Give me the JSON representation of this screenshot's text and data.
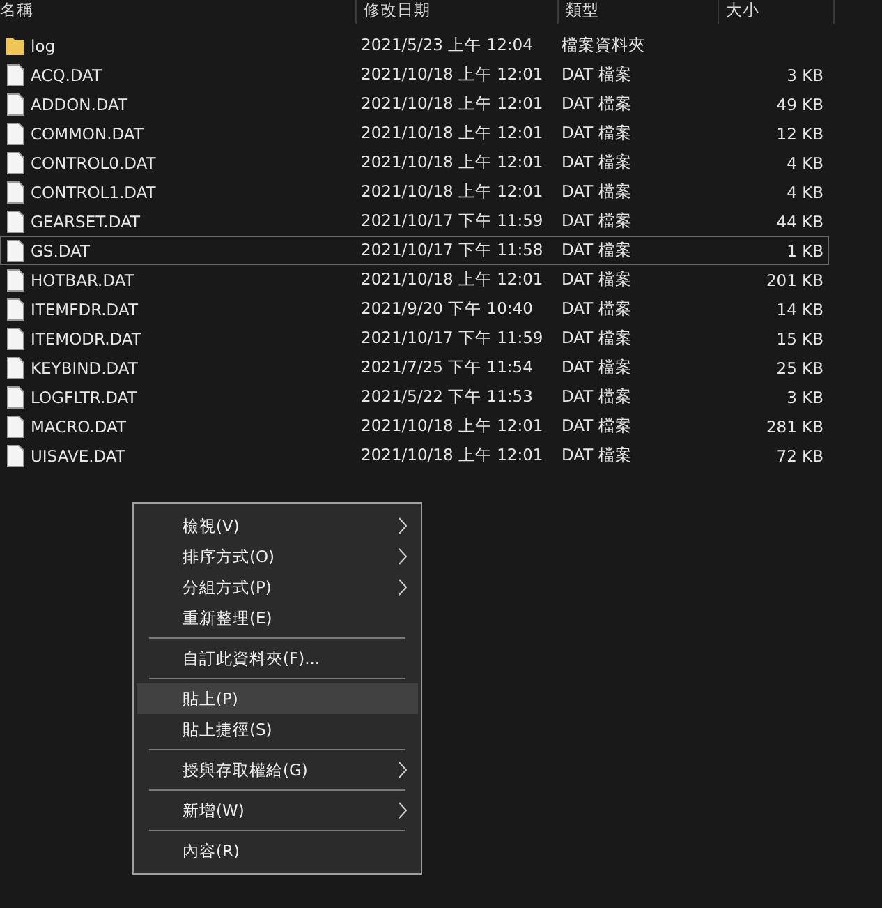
{
  "columns": [
    {
      "label": "名稱"
    },
    {
      "label": "修改日期"
    },
    {
      "label": "類型"
    },
    {
      "label": "大小"
    }
  ],
  "files": [
    {
      "kind": "folder",
      "name": "log",
      "modified": "2021/5/23 上午 12:04",
      "type": "檔案資料夾",
      "focused": false
    },
    {
      "kind": "file",
      "name": "ACQ.DAT",
      "modified": "2021/10/18 上午 12:01",
      "type": "DAT 檔案",
      "size": "3 KB",
      "focused": false
    },
    {
      "kind": "file",
      "name": "ADDON.DAT",
      "modified": "2021/10/18 上午 12:01",
      "type": "DAT 檔案",
      "size": "49 KB",
      "focused": false
    },
    {
      "kind": "file",
      "name": "COMMON.DAT",
      "modified": "2021/10/18 上午 12:01",
      "type": "DAT 檔案",
      "size": "12 KB",
      "focused": false
    },
    {
      "kind": "file",
      "name": "CONTROL0.DAT",
      "modified": "2021/10/18 上午 12:01",
      "type": "DAT 檔案",
      "size": "4 KB",
      "focused": false
    },
    {
      "kind": "file",
      "name": "CONTROL1.DAT",
      "modified": "2021/10/18 上午 12:01",
      "type": "DAT 檔案",
      "size": "4 KB",
      "focused": false
    },
    {
      "kind": "file",
      "name": "GEARSET.DAT",
      "modified": "2021/10/17 下午 11:59",
      "type": "DAT 檔案",
      "size": "44 KB",
      "focused": false
    },
    {
      "kind": "file",
      "name": "GS.DAT",
      "modified": "2021/10/17 下午 11:58",
      "type": "DAT 檔案",
      "size": "1 KB",
      "focused": true
    },
    {
      "kind": "file",
      "name": "HOTBAR.DAT",
      "modified": "2021/10/18 上午 12:01",
      "type": "DAT 檔案",
      "size": "201 KB",
      "focused": false
    },
    {
      "kind": "file",
      "name": "ITEMFDR.DAT",
      "modified": "2021/9/20 下午 10:40",
      "type": "DAT 檔案",
      "size": "14 KB",
      "focused": false
    },
    {
      "kind": "file",
      "name": "ITEMODR.DAT",
      "modified": "2021/10/17 下午 11:59",
      "type": "DAT 檔案",
      "size": "15 KB",
      "focused": false
    },
    {
      "kind": "file",
      "name": "KEYBIND.DAT",
      "modified": "2021/7/25 下午 11:54",
      "type": "DAT 檔案",
      "size": "25 KB",
      "focused": false
    },
    {
      "kind": "file",
      "name": "LOGFLTR.DAT",
      "modified": "2021/5/22 下午 11:53",
      "type": "DAT 檔案",
      "size": "3 KB",
      "focused": false
    },
    {
      "kind": "file",
      "name": "MACRO.DAT",
      "modified": "2021/10/18 上午 12:01",
      "type": "DAT 檔案",
      "size": "281 KB",
      "focused": false
    },
    {
      "kind": "file",
      "name": "UISAVE.DAT",
      "modified": "2021/10/18 上午 12:01",
      "type": "DAT 檔案",
      "size": "72 KB",
      "focused": false
    }
  ],
  "context_menu": {
    "items": [
      {
        "kind": "item",
        "label": "檢視(V)",
        "submenu": true,
        "selected": false
      },
      {
        "kind": "item",
        "label": "排序方式(O)",
        "submenu": true,
        "selected": false
      },
      {
        "kind": "item",
        "label": "分組方式(P)",
        "submenu": true,
        "selected": false
      },
      {
        "kind": "item",
        "label": "重新整理(E)",
        "submenu": false,
        "selected": false
      },
      {
        "kind": "separator"
      },
      {
        "kind": "item",
        "label": "自訂此資料夾(F)...",
        "submenu": false,
        "selected": false
      },
      {
        "kind": "separator"
      },
      {
        "kind": "item",
        "label": "貼上(P)",
        "submenu": false,
        "selected": true
      },
      {
        "kind": "item",
        "label": "貼上捷徑(S)",
        "submenu": false,
        "selected": false
      },
      {
        "kind": "separator"
      },
      {
        "kind": "item",
        "label": "授與存取權給(G)",
        "submenu": true,
        "selected": false
      },
      {
        "kind": "separator"
      },
      {
        "kind": "item",
        "label": "新增(W)",
        "submenu": true,
        "selected": false
      },
      {
        "kind": "separator"
      },
      {
        "kind": "item",
        "label": "內容(R)",
        "submenu": false,
        "selected": false
      }
    ]
  }
}
